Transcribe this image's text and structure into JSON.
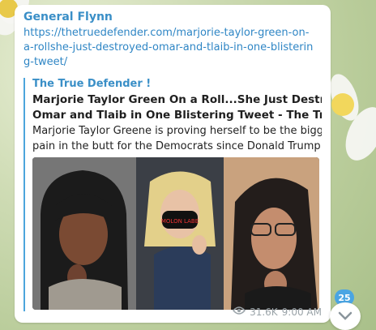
{
  "message": {
    "sender": "General Flynn",
    "link_text": "https://thetruedefender.com/marjorie-taylor-green-on-a-rollshe-just-destroyed-omar-and-tlaib-in-one-blistering-tweet/",
    "preview": {
      "site_name": "The True Defender !",
      "title_line1": "Marjorie Taylor Green On a Roll...She Just Destroyed",
      "title_line2": "Omar and Tlaib in One Blistering Tweet - The True Defe...",
      "desc_line1": "Marjorie Taylor Greene is proving herself to be the biggest",
      "desc_line2": "pain in the butt for the Democrats since Donald Trump. N...",
      "image_mask_text": "MOLON LABE"
    },
    "views": "31.6K",
    "time": "9:00 AM"
  },
  "unread_badge": "25",
  "icons": [
    "eye-icon",
    "chevron-down-icon"
  ]
}
